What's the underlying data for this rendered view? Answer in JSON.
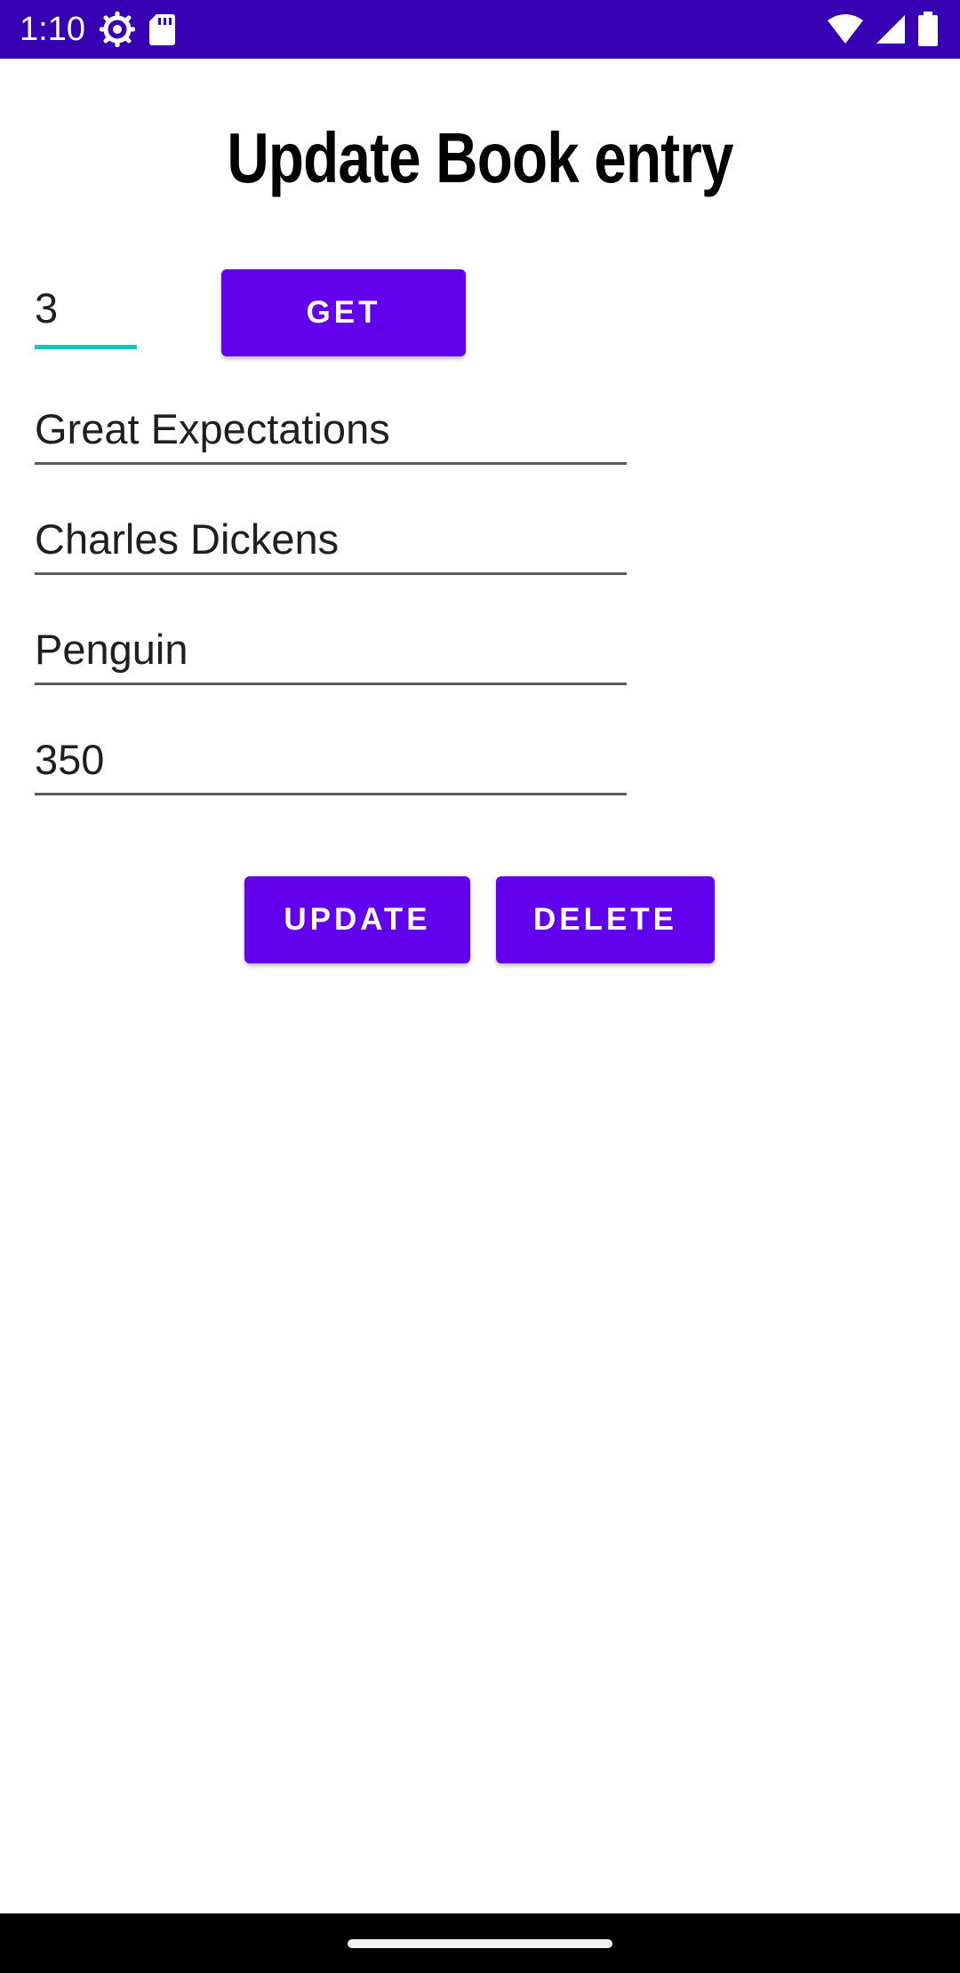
{
  "status_bar": {
    "time": "1:10",
    "left_icons": [
      "settings-gear-icon",
      "sd-card-icon"
    ],
    "right_icons": [
      "wifi-icon",
      "cell-signal-icon",
      "battery-icon"
    ],
    "background_color": "#3700b3"
  },
  "page": {
    "title": "Update Book entry"
  },
  "form": {
    "book_id": "3",
    "get_label": "GET",
    "title": "Great Expectations",
    "author": "Charles Dickens",
    "publisher": "Penguin",
    "pages": "350",
    "update_label": "UPDATE",
    "delete_label": "DELETE",
    "accent_color": "#18c5c0",
    "button_color": "#6200ee"
  }
}
